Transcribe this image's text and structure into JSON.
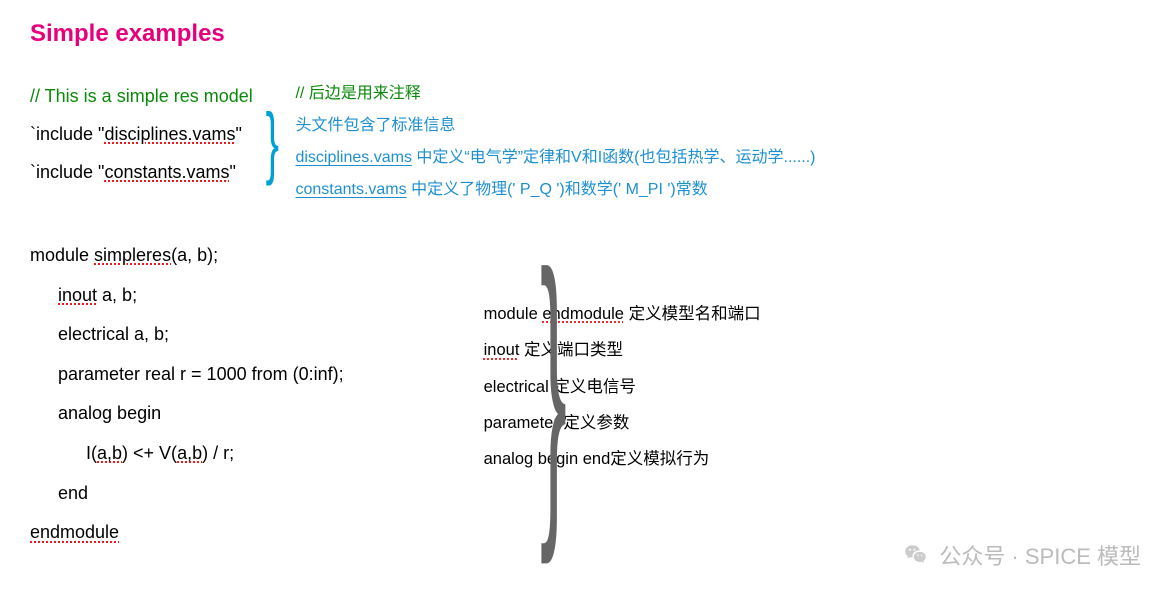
{
  "title": "Simple examples",
  "code1": {
    "comment": "// This is a simple res model",
    "inc1a": "`include \"",
    "inc1b": "disciplines.vams",
    "inc1c": "\"",
    "inc2a": "`include \"",
    "inc2b": "constants.vams",
    "inc2c": "\""
  },
  "anno1": {
    "l1": "// 后边是用来注释",
    "l2": "头文件包含了标准信息",
    "l3a": "disciplines.vams",
    "l3b": " 中定义“电气学”定律和V和I函数(也包括热学、运动学......)",
    "l4a": "constants.vams",
    "l4b": " 中定义了物理(' P_Q ')和数学(' M_PI ')常数"
  },
  "code2": {
    "l1a": "module ",
    "l1b": "simpleres",
    "l1c": "(a, b);",
    "l2a": "inout",
    "l2b": " a, b;",
    "l3": "electrical a, b;",
    "l4": "parameter real r = 1000 from (0:inf);",
    "l5": "analog begin",
    "l6a": "I(",
    "l6b": "a,b",
    "l6c": ") <+ V(",
    "l6d": "a,b",
    "l6e": ") / r;",
    "l7": "end",
    "l8": "endmodule"
  },
  "anno2": {
    "l1a": "module  ",
    "l1b": "endmodule",
    "l1c": " 定义模型名和端口",
    "l2a": "inout",
    "l2b": " 定义端口类型",
    "l3": "electrical 定义电信号",
    "l4": "parameter 定义参数",
    "l5": "analog begin end定义模拟行为"
  },
  "watermark": "公众号 · SPICE 模型"
}
